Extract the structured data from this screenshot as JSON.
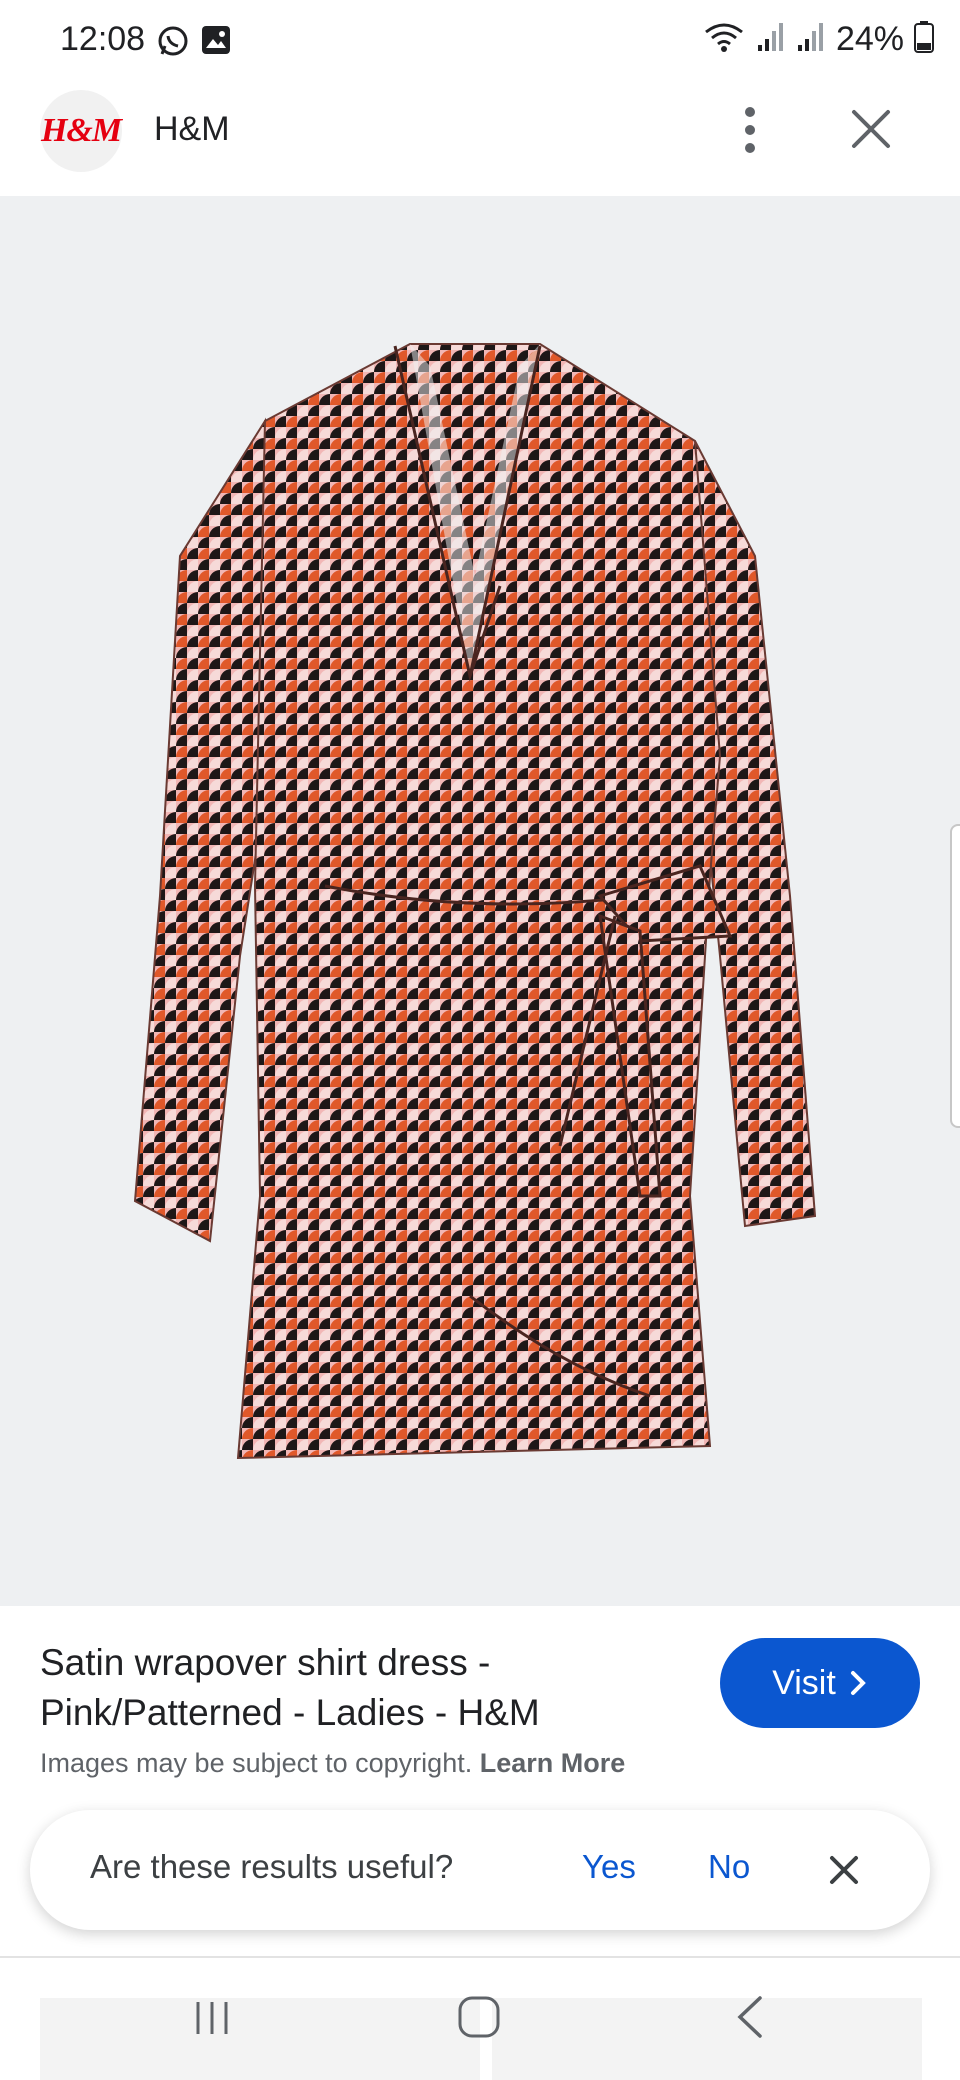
{
  "status_bar": {
    "time": "12:08",
    "battery": "24%",
    "icons": [
      "whatsapp-icon",
      "gallery-icon",
      "wifi-icon",
      "signal-icon",
      "signal-icon",
      "battery-icon"
    ]
  },
  "header": {
    "logo_text": "H&M",
    "site_name": "H&M",
    "icons": [
      "more-vert-icon",
      "close-icon"
    ]
  },
  "product": {
    "title": "Satin wrapover shirt dress - Pink/Patterned - Ladies - H&M",
    "visit_label": "Visit",
    "copyright": "Images may be subject to copyright.",
    "learn_more": "Learn More"
  },
  "feedback": {
    "question": "Are these results useful?",
    "yes": "Yes",
    "no": "No"
  },
  "colors": {
    "accent": "#0b57d0",
    "brand_red": "#e50010",
    "pattern_orange": "#e0582a",
    "pattern_pink": "#f1b6b5",
    "pattern_black": "#1e1717"
  }
}
